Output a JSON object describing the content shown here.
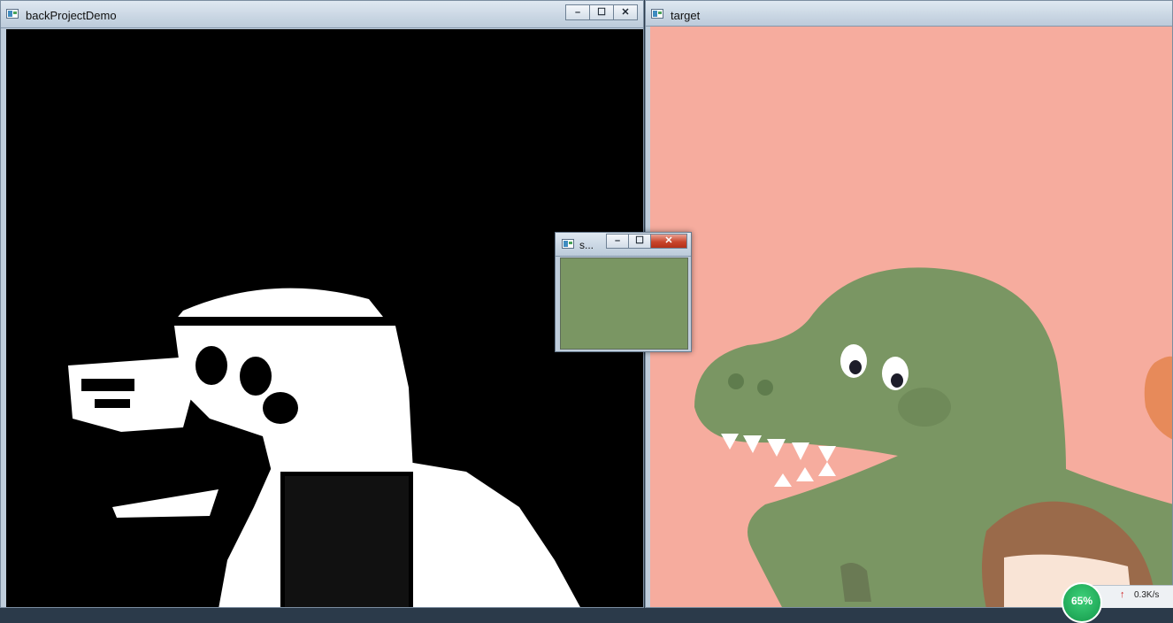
{
  "windows": {
    "back_project": {
      "title": "backProjectDemo"
    },
    "target": {
      "title": "target"
    },
    "sample": {
      "title": "s..."
    }
  },
  "controls": {
    "minimize": "–",
    "maximize": "☐",
    "close": "✕"
  },
  "tray": {
    "percent": "65%",
    "speed": "0.3K/s",
    "arrow": "↑"
  },
  "colors": {
    "target_background": "#f6ac9e",
    "dino_green": "#7a9663",
    "sample_swatch": "#7a9663",
    "backproject_background": "#000000"
  }
}
